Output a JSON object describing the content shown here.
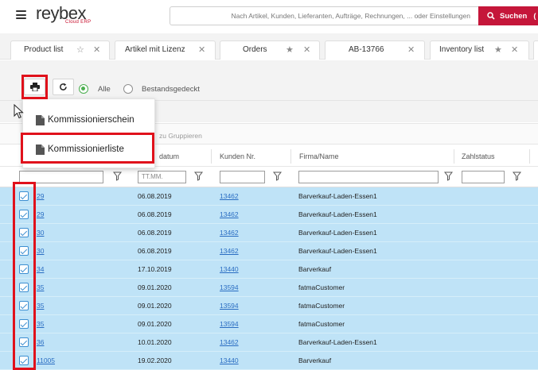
{
  "header": {
    "brand": "reybex",
    "brand_sub": "Cloud ERP",
    "search_placeholder": "Nach Artikel, Kunden, Lieferanten, Aufträge, Rechnungen, ... oder Einstellungen",
    "search_button": "Suchen",
    "search_button_suffix": "("
  },
  "tabs": [
    {
      "label": "Product list",
      "star": true,
      "close": true
    },
    {
      "label": "Artikel mit Lizenz",
      "star": false,
      "close": true
    },
    {
      "label": "Orders",
      "star": true,
      "close": true
    },
    {
      "label": "AB-13766",
      "star": false,
      "close": true
    },
    {
      "label": "Inventory list",
      "star": true,
      "close": true
    }
  ],
  "toolbar": {
    "filter_all": "Alle",
    "filter_stock": "Bestandsgedeckt",
    "selected_filter": "Alle"
  },
  "menu": {
    "items": [
      "Kommissionierschein",
      "Kommissionierliste"
    ],
    "highlighted": "Kommissionierliste"
  },
  "group_hint": "zu Gruppieren",
  "table": {
    "columns": [
      "datum",
      "Kunden Nr.",
      "Firma/Name",
      "Zahlstatus"
    ],
    "date_placeholder": "TT.MM.",
    "rows": [
      {
        "nr": "29",
        "date": "06.08.2019",
        "customer": "13462",
        "company": "Barverkauf-Laden-Essen1"
      },
      {
        "nr": "29",
        "date": "06.08.2019",
        "customer": "13462",
        "company": "Barverkauf-Laden-Essen1"
      },
      {
        "nr": "30",
        "date": "06.08.2019",
        "customer": "13462",
        "company": "Barverkauf-Laden-Essen1"
      },
      {
        "nr": "30",
        "date": "06.08.2019",
        "customer": "13462",
        "company": "Barverkauf-Laden-Essen1"
      },
      {
        "nr": "34",
        "date": "17.10.2019",
        "customer": "13440",
        "company": "Barverkauf"
      },
      {
        "nr": "35",
        "date": "09.01.2020",
        "customer": "13594",
        "company": "fatmaCustomer"
      },
      {
        "nr": "35",
        "date": "09.01.2020",
        "customer": "13594",
        "company": "fatmaCustomer"
      },
      {
        "nr": "35",
        "date": "09.01.2020",
        "customer": "13594",
        "company": "fatmaCustomer"
      },
      {
        "nr": "36",
        "date": "10.01.2020",
        "customer": "13462",
        "company": "Barverkauf-Laden-Essen1"
      },
      {
        "nr": "11005",
        "date": "19.02.2020",
        "customer": "13440",
        "company": "Barverkauf"
      }
    ]
  },
  "colors": {
    "accent": "#c5163a",
    "row_selected": "#bfe3f7",
    "link": "#2a6dc2",
    "highlight": "#e0111b",
    "radio_on": "#4caf50"
  }
}
